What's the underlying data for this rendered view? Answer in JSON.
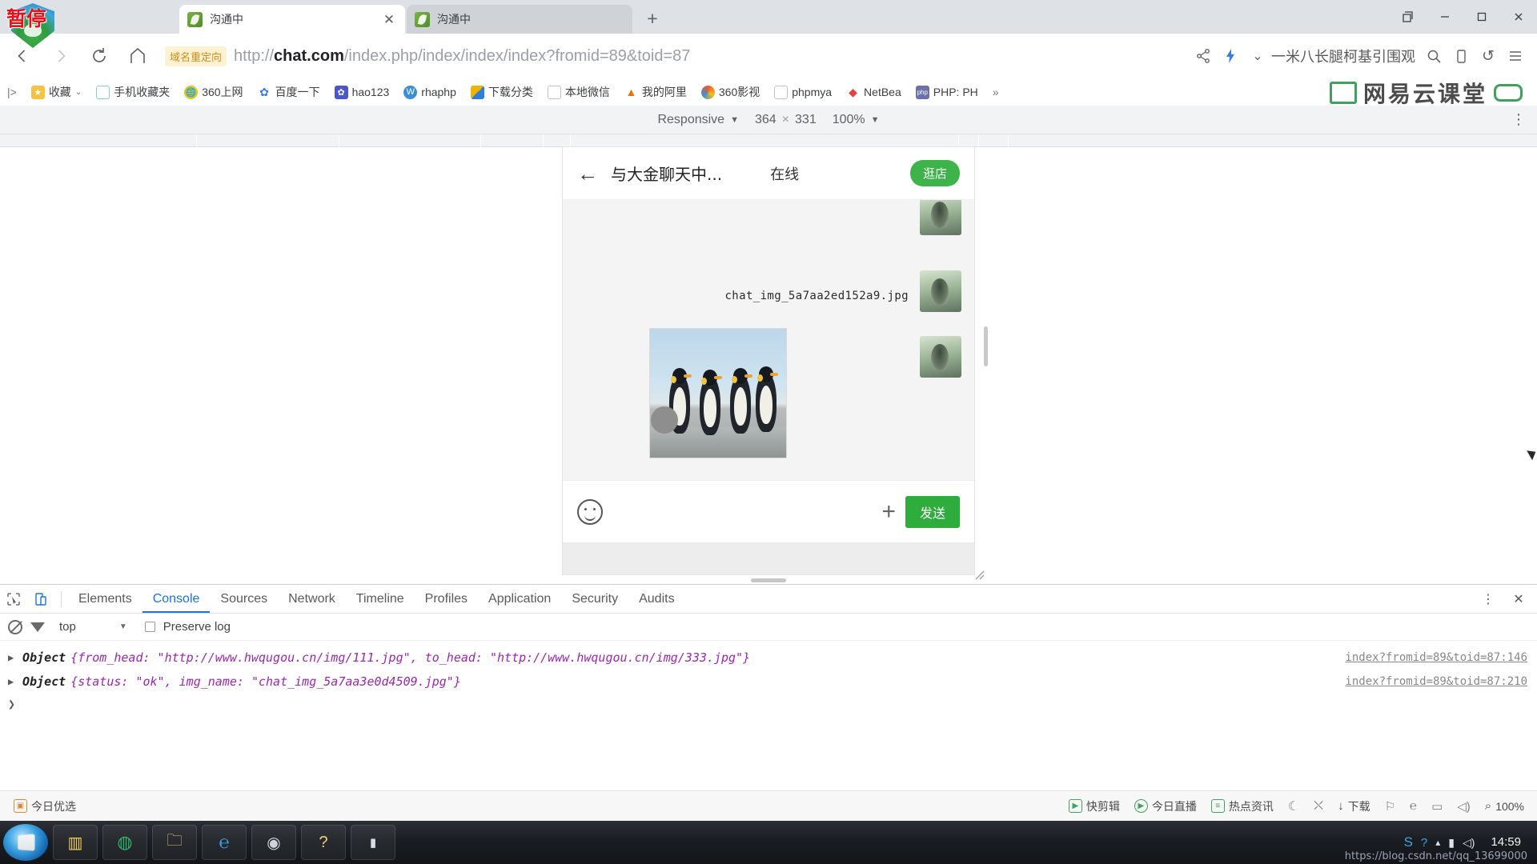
{
  "browser": {
    "overlay_badge": "暂停",
    "tabs": [
      {
        "title": "沟通中",
        "active": true,
        "close_label": "✕"
      },
      {
        "title": "沟通中",
        "active": false,
        "close_label": ""
      }
    ],
    "new_tab_label": "+",
    "window_controls": {
      "restore_down": "❐",
      "minimize": "─",
      "maximize": "❐",
      "close": "✕"
    },
    "nav": {
      "back": "‹",
      "forward": "›",
      "reload": "⟳",
      "home": "⌂"
    },
    "omnibox": {
      "redirect_badge": "域名重定向",
      "url_prefix": "http://",
      "url_domain": "chat.com",
      "url_path": "/index.php/index/index/index?fromid=89&toid=87",
      "share_icon": "share-icon",
      "lightning_icon": "lightning-icon",
      "chevron": "⌄",
      "search_hint": "一米八长腿柯基引围观",
      "search_icon": "🔍",
      "mobile_icon": "mobile-icon",
      "undo_icon": "↺",
      "menu_icon": "≡"
    },
    "bookmarks": [
      {
        "label": "收藏",
        "icon": "star-icon",
        "color": "#f5c243",
        "chevron": "⌄"
      },
      {
        "label": "手机收藏夹",
        "icon": "phone-icon",
        "color": "#7fd4c1"
      },
      {
        "label": "360上网",
        "icon": "360-icon",
        "color": "#f2c015"
      },
      {
        "label": "百度一下",
        "icon": "baidu-icon",
        "color": "#3b7de0"
      },
      {
        "label": "hao123",
        "icon": "hao123-icon",
        "color": "#4b56c9"
      },
      {
        "label": "rhaphp",
        "icon": "w-icon",
        "color": "#3a90d8"
      },
      {
        "label": "下载分类",
        "icon": "download-icon",
        "color": "#f0b400"
      },
      {
        "label": "本地微信",
        "icon": "page-icon",
        "color": "#bdbdbd"
      },
      {
        "label": "我的阿里",
        "icon": "ali-icon",
        "color": "#ff6a00"
      },
      {
        "label": "360影视",
        "icon": "360video-icon",
        "color": "#ef5a2c"
      },
      {
        "label": "phpmya",
        "icon": "page-icon",
        "color": "#bdbdbd"
      },
      {
        "label": "NetBea",
        "icon": "netbeans-icon",
        "color": "#e8413c"
      },
      {
        "label": "PHP: PH",
        "icon": "php-icon",
        "color": "#6a72a8"
      },
      {
        "label": "»",
        "icon": "overflow-icon",
        "color": "transparent"
      }
    ],
    "bookmark_expand": "|>",
    "netease_watermark": "网易云课堂"
  },
  "device_toolbar": {
    "device_label": "Responsive",
    "device_chevron": "▼",
    "width": "364",
    "multiply": "×",
    "height": "331",
    "zoom": "100%",
    "zoom_chevron": "▼",
    "kebab": "⋮"
  },
  "page": {
    "chat": {
      "back_icon": "←",
      "title": "与大金聊天中...",
      "status": "在线",
      "shop_button": "逛店",
      "message_filename": "chat_img_5a7aa2ed152a9.jpg",
      "input": {
        "emoji_icon": "smiley-icon",
        "plus_label": "+",
        "send_label": "发送"
      }
    }
  },
  "devtools": {
    "tabs": [
      {
        "label": "Elements",
        "active": false
      },
      {
        "label": "Console",
        "active": true
      },
      {
        "label": "Sources",
        "active": false
      },
      {
        "label": "Network",
        "active": false
      },
      {
        "label": "Timeline",
        "active": false
      },
      {
        "label": "Profiles",
        "active": false
      },
      {
        "label": "Application",
        "active": false
      },
      {
        "label": "Security",
        "active": false
      },
      {
        "label": "Audits",
        "active": false
      }
    ],
    "inspect_icon": "inspect-icon",
    "device-toggle_icon": "device-toggle-icon",
    "more_icon": "⋮",
    "close_icon": "✕",
    "filters": {
      "clear_icon": "clear-console-icon",
      "filter_icon": "filter-icon",
      "context": "top",
      "context_chevron": "▼",
      "preserve_log": "Preserve log"
    },
    "console_logs": [
      {
        "disclosure": "▶",
        "type": "Object",
        "body": "{from_head: \"http://www.hwqugou.cn/img/111.jpg\", to_head: \"http://www.hwqugou.cn/img/333.jpg\"}",
        "source": "index?fromid=89&toid=87:146"
      },
      {
        "disclosure": "▶",
        "type": "Object",
        "body": "{status: \"ok\", img_name: \"chat_img_5a7aa3e0d4509.jpg\"}",
        "source": "index?fromid=89&toid=87:210"
      }
    ],
    "prompt": "❯"
  },
  "statusbar": {
    "left_item": {
      "label": "今日优选",
      "icon": "gift-icon"
    },
    "right_items": [
      {
        "label": "快剪辑",
        "icon": "clip-icon"
      },
      {
        "label": "今日直播",
        "icon": "live-icon"
      },
      {
        "label": "热点资讯",
        "icon": "news-icon"
      },
      {
        "label": "",
        "icon": "moon-icon"
      },
      {
        "label": "",
        "icon": "mute-icon"
      },
      {
        "label": "下载",
        "icon": "download-arrow-icon"
      },
      {
        "label": "",
        "icon": "flag-icon"
      },
      {
        "label": "",
        "icon": "gesture-icon"
      },
      {
        "label": "",
        "icon": "window-icon"
      },
      {
        "label": "",
        "icon": "sound-icon"
      },
      {
        "label": "100%",
        "icon": "zoom-icon"
      }
    ]
  },
  "taskbar": {
    "start_label": "start-orb",
    "apps": [
      {
        "name": "app-rm",
        "icon": "rm-icon"
      },
      {
        "name": "app-360",
        "icon": "360-safe-icon"
      },
      {
        "name": "app-folder",
        "icon": "folder-icon"
      },
      {
        "name": "app-ie",
        "icon": "ie-icon"
      },
      {
        "name": "app-obs",
        "icon": "obs-icon"
      },
      {
        "name": "app-help",
        "icon": "help-icon"
      },
      {
        "name": "app-console",
        "icon": "console-icon"
      }
    ],
    "tray": [
      "sogou-icon",
      "help-circle-icon",
      "caret-icon",
      "network-icon",
      "volume-icon"
    ],
    "time": "14:59",
    "date": "",
    "watermark": "https://blog.csdn.net/qq_13699000"
  }
}
